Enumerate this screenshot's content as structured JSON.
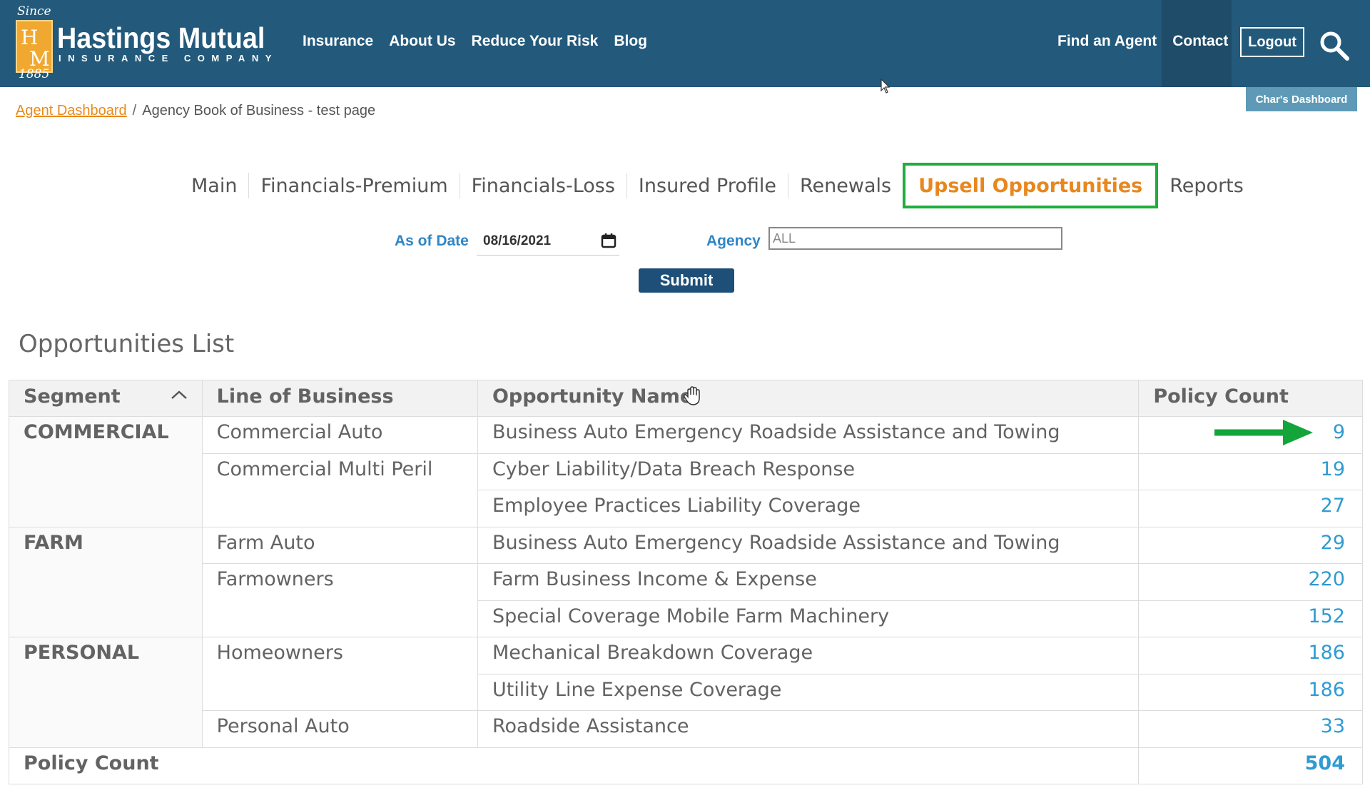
{
  "header": {
    "logo": {
      "since": "Since",
      "letters": [
        "H",
        "M"
      ],
      "year": "1885",
      "name": "Hastings Mutual",
      "subtitle": "INSURANCE COMPANY"
    },
    "nav": [
      "Insurance",
      "About Us",
      "Reduce Your Risk",
      "Blog"
    ],
    "right_nav": [
      "Find an Agent",
      "Contact"
    ],
    "logout_label": "Logout",
    "search_icon": "search-icon",
    "dashboard_badge": "Char's Dashboard"
  },
  "breadcrumb": {
    "link": "Agent Dashboard",
    "separator": "/",
    "current": "Agency Book of Business - test page"
  },
  "tabs": [
    "Main",
    "Financials-Premium",
    "Financials-Loss",
    "Insured Profile",
    "Renewals",
    "Upsell Opportunities",
    "Reports"
  ],
  "active_tab": "Upsell Opportunities",
  "filters": {
    "date_label": "As of Date",
    "date_value": "08/16/2021",
    "agency_label": "Agency",
    "agency_value": "ALL",
    "submit_label": "Submit"
  },
  "list": {
    "title": "Opportunities List",
    "columns": [
      "Segment",
      "Line of Business",
      "Opportunity Name",
      "Policy Count"
    ],
    "rows": [
      {
        "segment": "COMMERCIAL",
        "line": "Commercial Auto",
        "opportunity": "Business Auto Emergency Roadside Assistance and Towing",
        "count": "9"
      },
      {
        "segment": "",
        "line": "Commercial Multi Peril",
        "opportunity": "Cyber Liability/Data Breach Response",
        "count": "19"
      },
      {
        "segment": "",
        "line": "",
        "opportunity": "Employee Practices Liability Coverage",
        "count": "27"
      },
      {
        "segment": "FARM",
        "line": "Farm Auto",
        "opportunity": "Business Auto Emergency Roadside Assistance and Towing",
        "count": "29"
      },
      {
        "segment": "",
        "line": "Farmowners",
        "opportunity": "Farm Business Income & Expense",
        "count": "220"
      },
      {
        "segment": "",
        "line": "",
        "opportunity": "Special Coverage Mobile Farm Machinery",
        "count": "152"
      },
      {
        "segment": "PERSONAL",
        "line": "Homeowners",
        "opportunity": "Mechanical Breakdown Coverage",
        "count": "186"
      },
      {
        "segment": "",
        "line": "",
        "opportunity": "Utility Line Expense Coverage",
        "count": "186"
      },
      {
        "segment": "",
        "line": "Personal Auto",
        "opportunity": "Roadside Assistance",
        "count": "33"
      }
    ],
    "total_label": "Policy Count",
    "total_value": "504"
  },
  "colors": {
    "header_bg": "#235a7c",
    "accent_orange": "#e8871e",
    "highlight_green": "#1fae3e",
    "link_blue": "#2f9bd1",
    "submit_bg": "#1d4f78"
  }
}
